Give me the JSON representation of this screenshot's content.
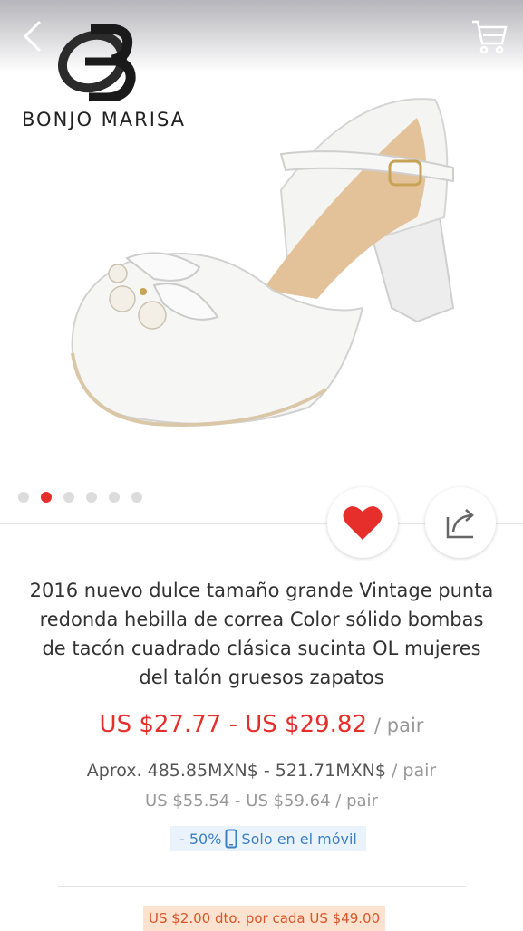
{
  "header": {
    "back_icon": "chevron-left-icon",
    "cart_icon": "cart-icon"
  },
  "brand": {
    "name": "BONJO MARISA"
  },
  "gallery": {
    "image_count": 6,
    "active_index": 1
  },
  "actions": {
    "favorite_icon": "heart-icon",
    "share_icon": "share-icon",
    "favorite_color": "#e62e2b"
  },
  "product": {
    "title": "2016 nuevo dulce tamaño grande Vintage punta redonda hebilla de correa Color sólido bombas de tacón cuadrado clásica sucinta OL mujeres del talón gruesos zapatos",
    "price": "US $27.77 - US $29.82",
    "price_unit": "/ pair",
    "approx_price": "Aprox. 485.85MXN$ - 521.71MXN$",
    "approx_unit": "/ pair",
    "original_price": "US $55.54 - US $59.64 / pair",
    "discount": "- 50%",
    "mobile_label": "Solo en el móvil",
    "coupon": "US $2.00 dto. por cada US $49.00"
  },
  "colors": {
    "accent": "#e62e2b",
    "badge_blue": "#3c7fc3",
    "coupon_orange": "#d9562a"
  }
}
